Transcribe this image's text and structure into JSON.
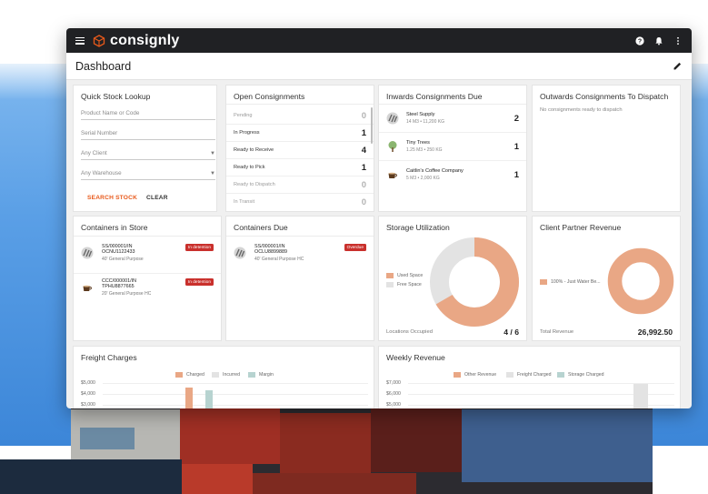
{
  "app": {
    "brand": "consignly",
    "page_title": "Dashboard"
  },
  "colors": {
    "accent": "#e8591a",
    "used": "#e9a785",
    "free": "#e3e3e3",
    "margin": "#b7d3d0",
    "badge": "#c9302c"
  },
  "quick_stock": {
    "title": "Quick Stock Lookup",
    "product_placeholder": "Product Name or Code",
    "serial_placeholder": "Serial Number",
    "client_select": "Any Client",
    "warehouse_select": "Any Warehouse",
    "search_label": "SEARCH STOCK",
    "clear_label": "CLEAR"
  },
  "open_consignments": {
    "title": "Open Consignments",
    "rows": [
      {
        "label": "Pending",
        "count": "0"
      },
      {
        "label": "In Progress",
        "count": "1"
      },
      {
        "label": "Ready to Receive",
        "count": "4"
      },
      {
        "label": "Ready to Pick",
        "count": "1"
      },
      {
        "label": "Ready to Dispatch",
        "count": "0"
      },
      {
        "label": "In Transit",
        "count": "0"
      }
    ]
  },
  "inwards": {
    "title": "Inwards Consignments Due",
    "items": [
      {
        "name": "Steel Supply",
        "detail": "14 M3 • 11,200 KG",
        "count": "2",
        "icon": "steel-icon"
      },
      {
        "name": "Tiny Trees",
        "detail": "1.25 M3 • 250 KG",
        "count": "1",
        "icon": "tree-icon"
      },
      {
        "name": "Caitlin's Coffee Company",
        "detail": "5 M3 • 2,000 KG",
        "count": "1",
        "icon": "coffee-icon"
      }
    ]
  },
  "outwards": {
    "title": "Outwards Consignments To Dispatch",
    "empty": "No consignments ready to dispatch"
  },
  "containers_in_store": {
    "title": "Containers in Store",
    "items": [
      {
        "ref": "SS/000001/IN",
        "number": "OCNU1122433",
        "type": "40' General Purpose",
        "badge": "In detention",
        "icon": "steel-icon"
      },
      {
        "ref": "CCC/000001/IN",
        "number": "TPHU8877665",
        "type": "20' General Purpose HC",
        "badge": "In detention",
        "icon": "coffee-icon"
      }
    ]
  },
  "containers_due": {
    "title": "Containers Due",
    "items": [
      {
        "ref": "SS/000001/IN",
        "number": "OCLU8899889",
        "type": "40' General Purpose HC",
        "badge": "Overdue",
        "icon": "steel-icon"
      }
    ]
  },
  "storage": {
    "title": "Storage Utilization",
    "legend": [
      "Used Space",
      "Free Space"
    ],
    "footer_label": "Locations Occupied",
    "footer_value": "4 / 6",
    "used_fraction": 0.6667
  },
  "client_revenue": {
    "title": "Client Partner Revenue",
    "legend": [
      "100% - Just Water Be..."
    ],
    "footer_label": "Total Revenue",
    "footer_value": "26,992.50",
    "fraction": 1.0
  },
  "freight": {
    "title": "Freight Charges",
    "legend": [
      "Charged",
      "Incurred",
      "Margin"
    ],
    "ticks": [
      "$5,000",
      "$4,000",
      "$3,000"
    ]
  },
  "weekly": {
    "title": "Weekly Revenue",
    "legend": [
      "Other Revenue",
      "Freight Charged",
      "Storage Charged"
    ],
    "ticks": [
      "$7,000",
      "$6,000",
      "$5,000"
    ]
  }
}
